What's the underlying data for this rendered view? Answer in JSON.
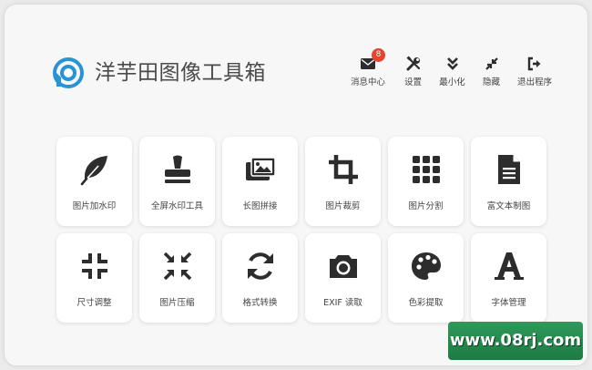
{
  "app": {
    "title": "洋芋田图像工具箱"
  },
  "topbar": {
    "messages": {
      "label": "消息中心",
      "badge": "8"
    },
    "settings": {
      "label": "设置"
    },
    "minimize": {
      "label": "最小化"
    },
    "hide": {
      "label": "隐藏"
    },
    "exit": {
      "label": "退出程序"
    }
  },
  "tools": [
    {
      "label": "图片加水印",
      "icon": "feather-icon"
    },
    {
      "label": "全屏水印工具",
      "icon": "stamp-icon"
    },
    {
      "label": "长图拼接",
      "icon": "images-icon"
    },
    {
      "label": "图片裁剪",
      "icon": "crop-icon"
    },
    {
      "label": "图片分割",
      "icon": "grid-icon"
    },
    {
      "label": "富文本制图",
      "icon": "document-icon"
    },
    {
      "label": "尺寸调整",
      "icon": "compress-icon"
    },
    {
      "label": "图片压缩",
      "icon": "shrink-icon"
    },
    {
      "label": "格式转换",
      "icon": "sync-icon"
    },
    {
      "label": "EXIF 读取",
      "icon": "camera-icon"
    },
    {
      "label": "色彩提取",
      "icon": "palette-icon"
    },
    {
      "label": "字体管理",
      "icon": "font-icon"
    }
  ],
  "watermark": {
    "text": "www.08rj.com"
  },
  "colors": {
    "icon": "#2d2d2d",
    "logo": "#2a93d5",
    "badge": "#e8432e",
    "watermark": "#1d7a43"
  }
}
